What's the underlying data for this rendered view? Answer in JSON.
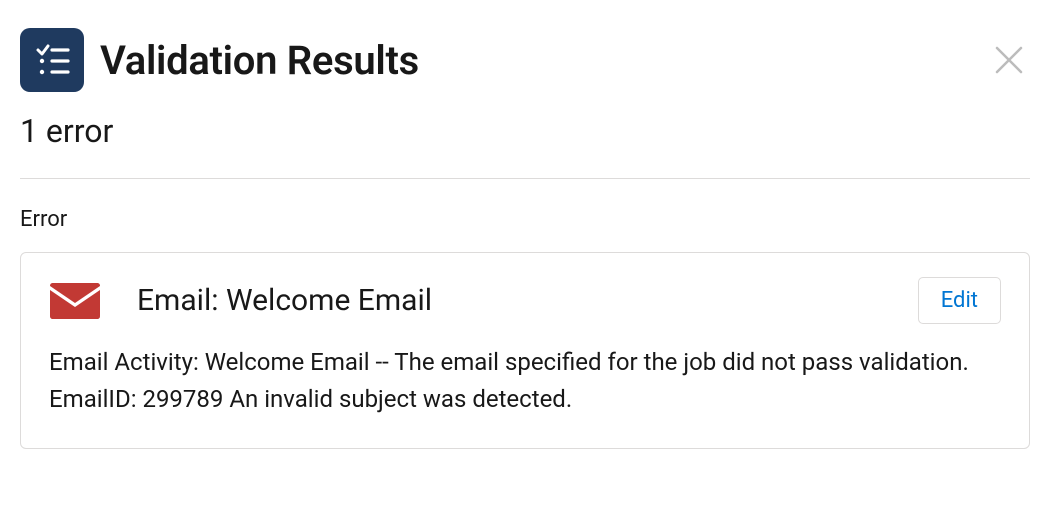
{
  "header": {
    "title": "Validation Results"
  },
  "summary": {
    "count_text": "1 error"
  },
  "section": {
    "label": "Error"
  },
  "errors": [
    {
      "title": "Email: Welcome Email",
      "edit_label": "Edit",
      "message": "Email Activity: Welcome Email -- The email specified for the job did not pass validation. EmailID: 299789 An invalid subject was detected."
    }
  ]
}
